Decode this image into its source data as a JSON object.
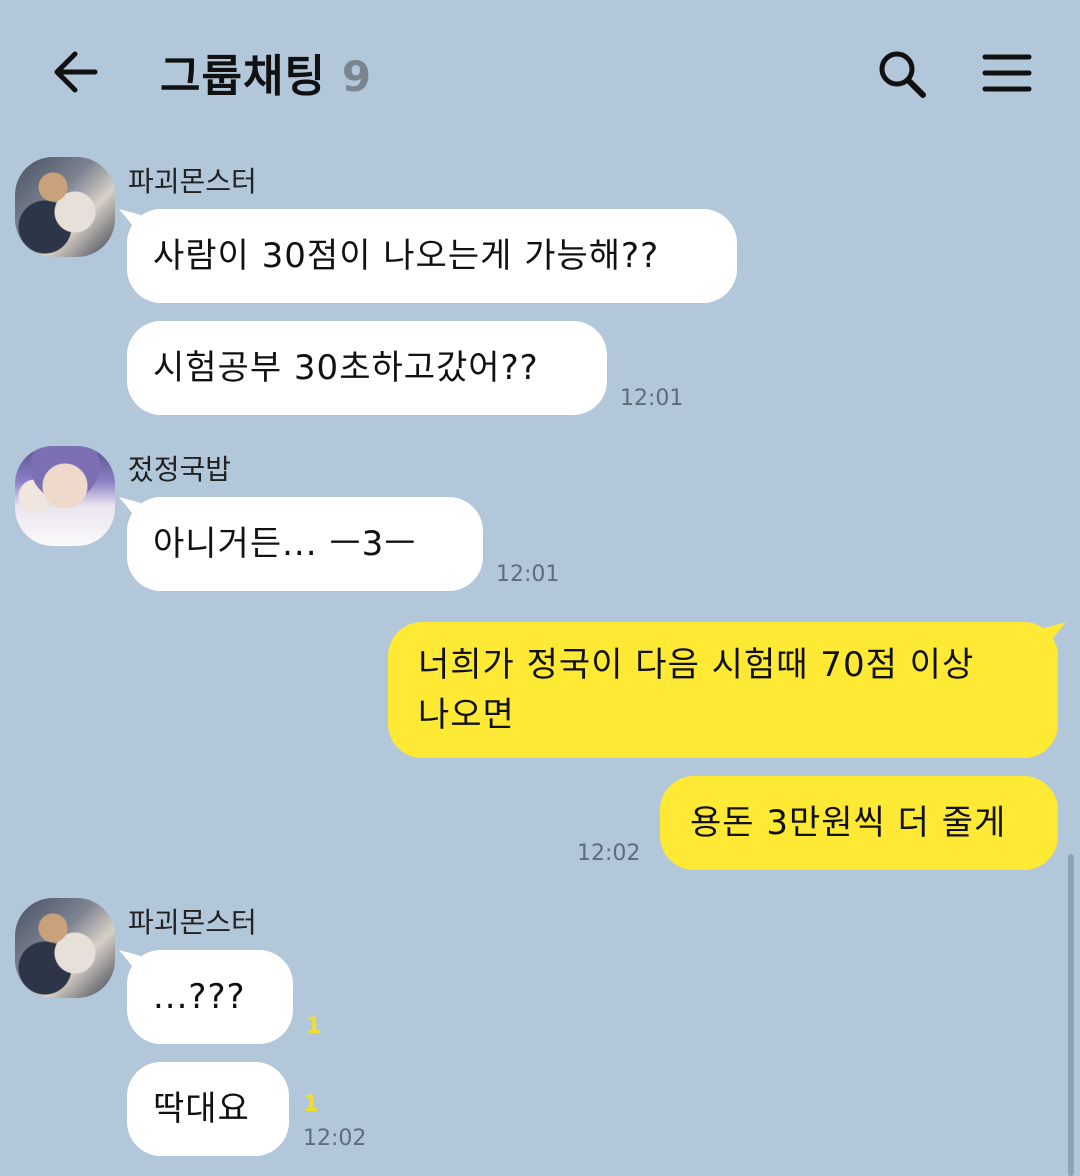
{
  "header": {
    "title": "그룹채팅",
    "member_count": "9",
    "back_icon": "arrow-left-icon",
    "search_icon": "search-icon",
    "menu_icon": "hamburger-menu-icon"
  },
  "colors": {
    "background": "#b2c7da",
    "incoming_bubble": "#ffffff",
    "outgoing_bubble": "#fee934",
    "unread_count": "#f1df2a"
  },
  "messages": [
    {
      "sender": "파괴몬스터",
      "avatar_icon": "profile-photo-avatar",
      "bubbles": [
        {
          "text": "사람이 30점이 나오는게 가능해??"
        },
        {
          "text": "시험공부 30초하고갔어??",
          "time": "12:01"
        }
      ]
    },
    {
      "sender": "젔정국밥",
      "avatar_icon": "profile-photo-avatar",
      "bubbles": [
        {
          "text": "아니거든... ㅡ3ㅡ",
          "time": "12:01"
        }
      ]
    },
    {
      "sender": "",
      "outgoing": true,
      "bubbles": [
        {
          "line1": "너희가 정국이 다음 시험때 70점 이상",
          "line2": "나오면"
        },
        {
          "text": "용돈 3만원씩 더 줄게",
          "time": "12:02"
        }
      ]
    },
    {
      "sender": "파괴몬스터",
      "avatar_icon": "profile-photo-avatar",
      "bubbles": [
        {
          "text": "...???",
          "unread": "1"
        },
        {
          "text": "딱대요",
          "unread": "1",
          "time": "12:02"
        }
      ]
    }
  ]
}
